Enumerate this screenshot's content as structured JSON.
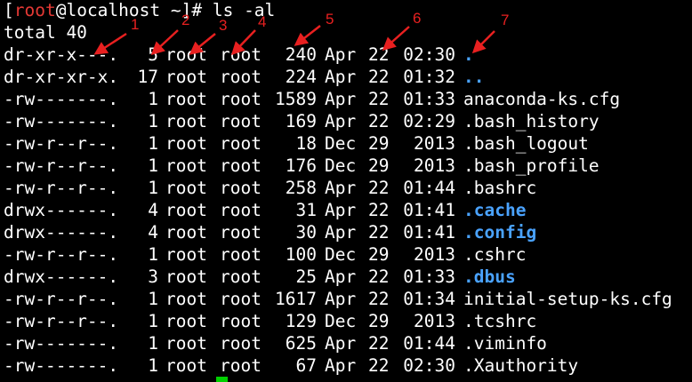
{
  "prompt": {
    "open_bracket": "[",
    "user": "root",
    "at_host": "@localhost ",
    "cwd": "~",
    "close": "]# ",
    "command": "ls -al"
  },
  "total_line": "total 40",
  "listing": [
    {
      "perm": "dr-xr-x---.",
      "links": "5",
      "user": "root",
      "group": "root",
      "size": "240",
      "month": "Apr",
      "day": "22",
      "time": "02:30",
      "name": ".",
      "is_dir": true
    },
    {
      "perm": "dr-xr-xr-x.",
      "links": "17",
      "user": "root",
      "group": "root",
      "size": "224",
      "month": "Apr",
      "day": "22",
      "time": "01:32",
      "name": "..",
      "is_dir": true
    },
    {
      "perm": "-rw-------.",
      "links": "1",
      "user": "root",
      "group": "root",
      "size": "1589",
      "month": "Apr",
      "day": "22",
      "time": "01:33",
      "name": "anaconda-ks.cfg",
      "is_dir": false
    },
    {
      "perm": "-rw-------.",
      "links": "1",
      "user": "root",
      "group": "root",
      "size": "169",
      "month": "Apr",
      "day": "22",
      "time": "02:29",
      "name": ".bash_history",
      "is_dir": false
    },
    {
      "perm": "-rw-r--r--.",
      "links": "1",
      "user": "root",
      "group": "root",
      "size": "18",
      "month": "Dec",
      "day": "29",
      "time": "2013",
      "name": ".bash_logout",
      "is_dir": false
    },
    {
      "perm": "-rw-r--r--.",
      "links": "1",
      "user": "root",
      "group": "root",
      "size": "176",
      "month": "Dec",
      "day": "29",
      "time": "2013",
      "name": ".bash_profile",
      "is_dir": false
    },
    {
      "perm": "-rw-r--r--.",
      "links": "1",
      "user": "root",
      "group": "root",
      "size": "258",
      "month": "Apr",
      "day": "22",
      "time": "01:44",
      "name": ".bashrc",
      "is_dir": false
    },
    {
      "perm": "drwx------.",
      "links": "4",
      "user": "root",
      "group": "root",
      "size": "31",
      "month": "Apr",
      "day": "22",
      "time": "01:41",
      "name": ".cache",
      "is_dir": true
    },
    {
      "perm": "drwx------.",
      "links": "4",
      "user": "root",
      "group": "root",
      "size": "30",
      "month": "Apr",
      "day": "22",
      "time": "01:41",
      "name": ".config",
      "is_dir": true
    },
    {
      "perm": "-rw-r--r--.",
      "links": "1",
      "user": "root",
      "group": "root",
      "size": "100",
      "month": "Dec",
      "day": "29",
      "time": "2013",
      "name": ".cshrc",
      "is_dir": false
    },
    {
      "perm": "drwx------.",
      "links": "3",
      "user": "root",
      "group": "root",
      "size": "25",
      "month": "Apr",
      "day": "22",
      "time": "01:33",
      "name": ".dbus",
      "is_dir": true
    },
    {
      "perm": "-rw-r--r--.",
      "links": "1",
      "user": "root",
      "group": "root",
      "size": "1617",
      "month": "Apr",
      "day": "22",
      "time": "01:34",
      "name": "initial-setup-ks.cfg",
      "is_dir": false
    },
    {
      "perm": "-rw-r--r--.",
      "links": "1",
      "user": "root",
      "group": "root",
      "size": "129",
      "month": "Dec",
      "day": "29",
      "time": "2013",
      "name": ".tcshrc",
      "is_dir": false
    },
    {
      "perm": "-rw-------.",
      "links": "1",
      "user": "root",
      "group": "root",
      "size": "625",
      "month": "Apr",
      "day": "22",
      "time": "01:44",
      "name": ".viminfo",
      "is_dir": false
    },
    {
      "perm": "-rw-------.",
      "links": "1",
      "user": "root",
      "group": "root",
      "size": "67",
      "month": "Apr",
      "day": "22",
      "time": "02:30",
      "name": ".Xauthority",
      "is_dir": false
    }
  ],
  "annotations": [
    "1",
    "2",
    "3",
    "4",
    "5",
    "6",
    "7"
  ],
  "colors": {
    "background": "#000000",
    "text": "#ffffff",
    "prompt_user": "#e53935",
    "directory": "#4aa3ff",
    "annotation": "#e82020",
    "cursor": "#00d000"
  }
}
